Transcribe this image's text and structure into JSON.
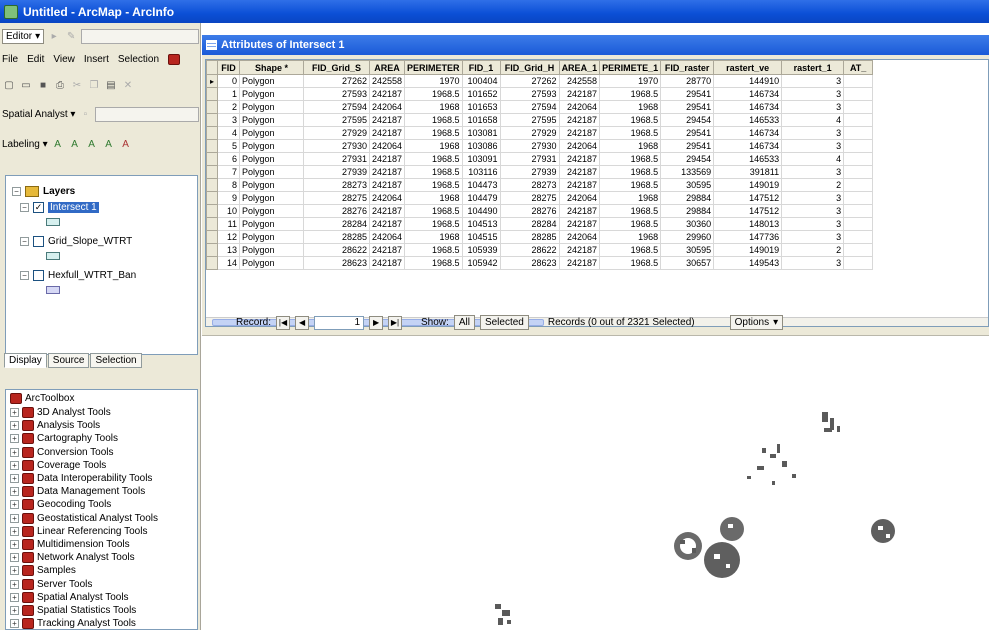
{
  "window": {
    "title": "Untitled - ArcMap - ArcInfo"
  },
  "toolbars": {
    "editor_label": "Editor",
    "menu": [
      "File",
      "Edit",
      "View",
      "Insert",
      "Selection"
    ],
    "spatial_analyst_label": "Spatial Analyst",
    "labeling_label": "Labeling"
  },
  "toc": {
    "root_label": "Layers",
    "layers": [
      {
        "name": "Intersect 1",
        "checked": true
      },
      {
        "name": "Grid_Slope_WTRT",
        "checked": false
      },
      {
        "name": "Hexfull_WTRT_Ban",
        "checked": false
      }
    ],
    "tabs": [
      "Display",
      "Source",
      "Selection"
    ]
  },
  "toolbox": {
    "root_label": "ArcToolbox",
    "items": [
      "3D Analyst Tools",
      "Analysis Tools",
      "Cartography Tools",
      "Conversion Tools",
      "Coverage Tools",
      "Data Interoperability Tools",
      "Data Management Tools",
      "Geocoding Tools",
      "Geostatistical Analyst Tools",
      "Linear Referencing Tools",
      "Multidimension Tools",
      "Network Analyst Tools",
      "Samples",
      "Server Tools",
      "Spatial Analyst Tools",
      "Spatial Statistics Tools",
      "Tracking Analyst Tools"
    ]
  },
  "attributes": {
    "title": "Attributes of Intersect 1",
    "columns": [
      "FID",
      "Shape *",
      "FID_Grid_S",
      "AREA",
      "PERIMETER",
      "FID_1",
      "FID_Grid_H",
      "AREA_1",
      "PERIMETE_1",
      "FID_raster",
      "rastert_ve",
      "rastert_1",
      "AT_"
    ],
    "rows": [
      [
        "0",
        "Polygon",
        "27262",
        "242558",
        "1970",
        "100404",
        "27262",
        "242558",
        "1970",
        "28770",
        "144910",
        "3",
        ""
      ],
      [
        "1",
        "Polygon",
        "27593",
        "242187",
        "1968.5",
        "101652",
        "27593",
        "242187",
        "1968.5",
        "29541",
        "146734",
        "3",
        ""
      ],
      [
        "2",
        "Polygon",
        "27594",
        "242064",
        "1968",
        "101653",
        "27594",
        "242064",
        "1968",
        "29541",
        "146734",
        "3",
        ""
      ],
      [
        "3",
        "Polygon",
        "27595",
        "242187",
        "1968.5",
        "101658",
        "27595",
        "242187",
        "1968.5",
        "29454",
        "146533",
        "4",
        ""
      ],
      [
        "4",
        "Polygon",
        "27929",
        "242187",
        "1968.5",
        "103081",
        "27929",
        "242187",
        "1968.5",
        "29541",
        "146734",
        "3",
        ""
      ],
      [
        "5",
        "Polygon",
        "27930",
        "242064",
        "1968",
        "103086",
        "27930",
        "242064",
        "1968",
        "29541",
        "146734",
        "3",
        ""
      ],
      [
        "6",
        "Polygon",
        "27931",
        "242187",
        "1968.5",
        "103091",
        "27931",
        "242187",
        "1968.5",
        "29454",
        "146533",
        "4",
        ""
      ],
      [
        "7",
        "Polygon",
        "27939",
        "242187",
        "1968.5",
        "103116",
        "27939",
        "242187",
        "1968.5",
        "133569",
        "391811",
        "3",
        ""
      ],
      [
        "8",
        "Polygon",
        "28273",
        "242187",
        "1968.5",
        "104473",
        "28273",
        "242187",
        "1968.5",
        "30595",
        "149019",
        "2",
        ""
      ],
      [
        "9",
        "Polygon",
        "28275",
        "242064",
        "1968",
        "104479",
        "28275",
        "242064",
        "1968",
        "29884",
        "147512",
        "3",
        ""
      ],
      [
        "10",
        "Polygon",
        "28276",
        "242187",
        "1968.5",
        "104490",
        "28276",
        "242187",
        "1968.5",
        "29884",
        "147512",
        "3",
        ""
      ],
      [
        "11",
        "Polygon",
        "28284",
        "242187",
        "1968.5",
        "104513",
        "28284",
        "242187",
        "1968.5",
        "30360",
        "148013",
        "3",
        ""
      ],
      [
        "12",
        "Polygon",
        "28285",
        "242064",
        "1968",
        "104515",
        "28285",
        "242064",
        "1968",
        "29960",
        "147736",
        "3",
        ""
      ],
      [
        "13",
        "Polygon",
        "28622",
        "242187",
        "1968.5",
        "105939",
        "28622",
        "242187",
        "1968.5",
        "30595",
        "149019",
        "2",
        ""
      ],
      [
        "14",
        "Polygon",
        "28623",
        "242187",
        "1968.5",
        "105942",
        "28623",
        "242187",
        "1968.5",
        "30657",
        "149543",
        "3",
        ""
      ]
    ],
    "record_label": "Record:",
    "record_value": "1",
    "show_label": "Show:",
    "show_all": "All",
    "show_selected": "Selected",
    "records_status": "Records (0 out of 2321 Selected)",
    "options_label": "Options"
  }
}
